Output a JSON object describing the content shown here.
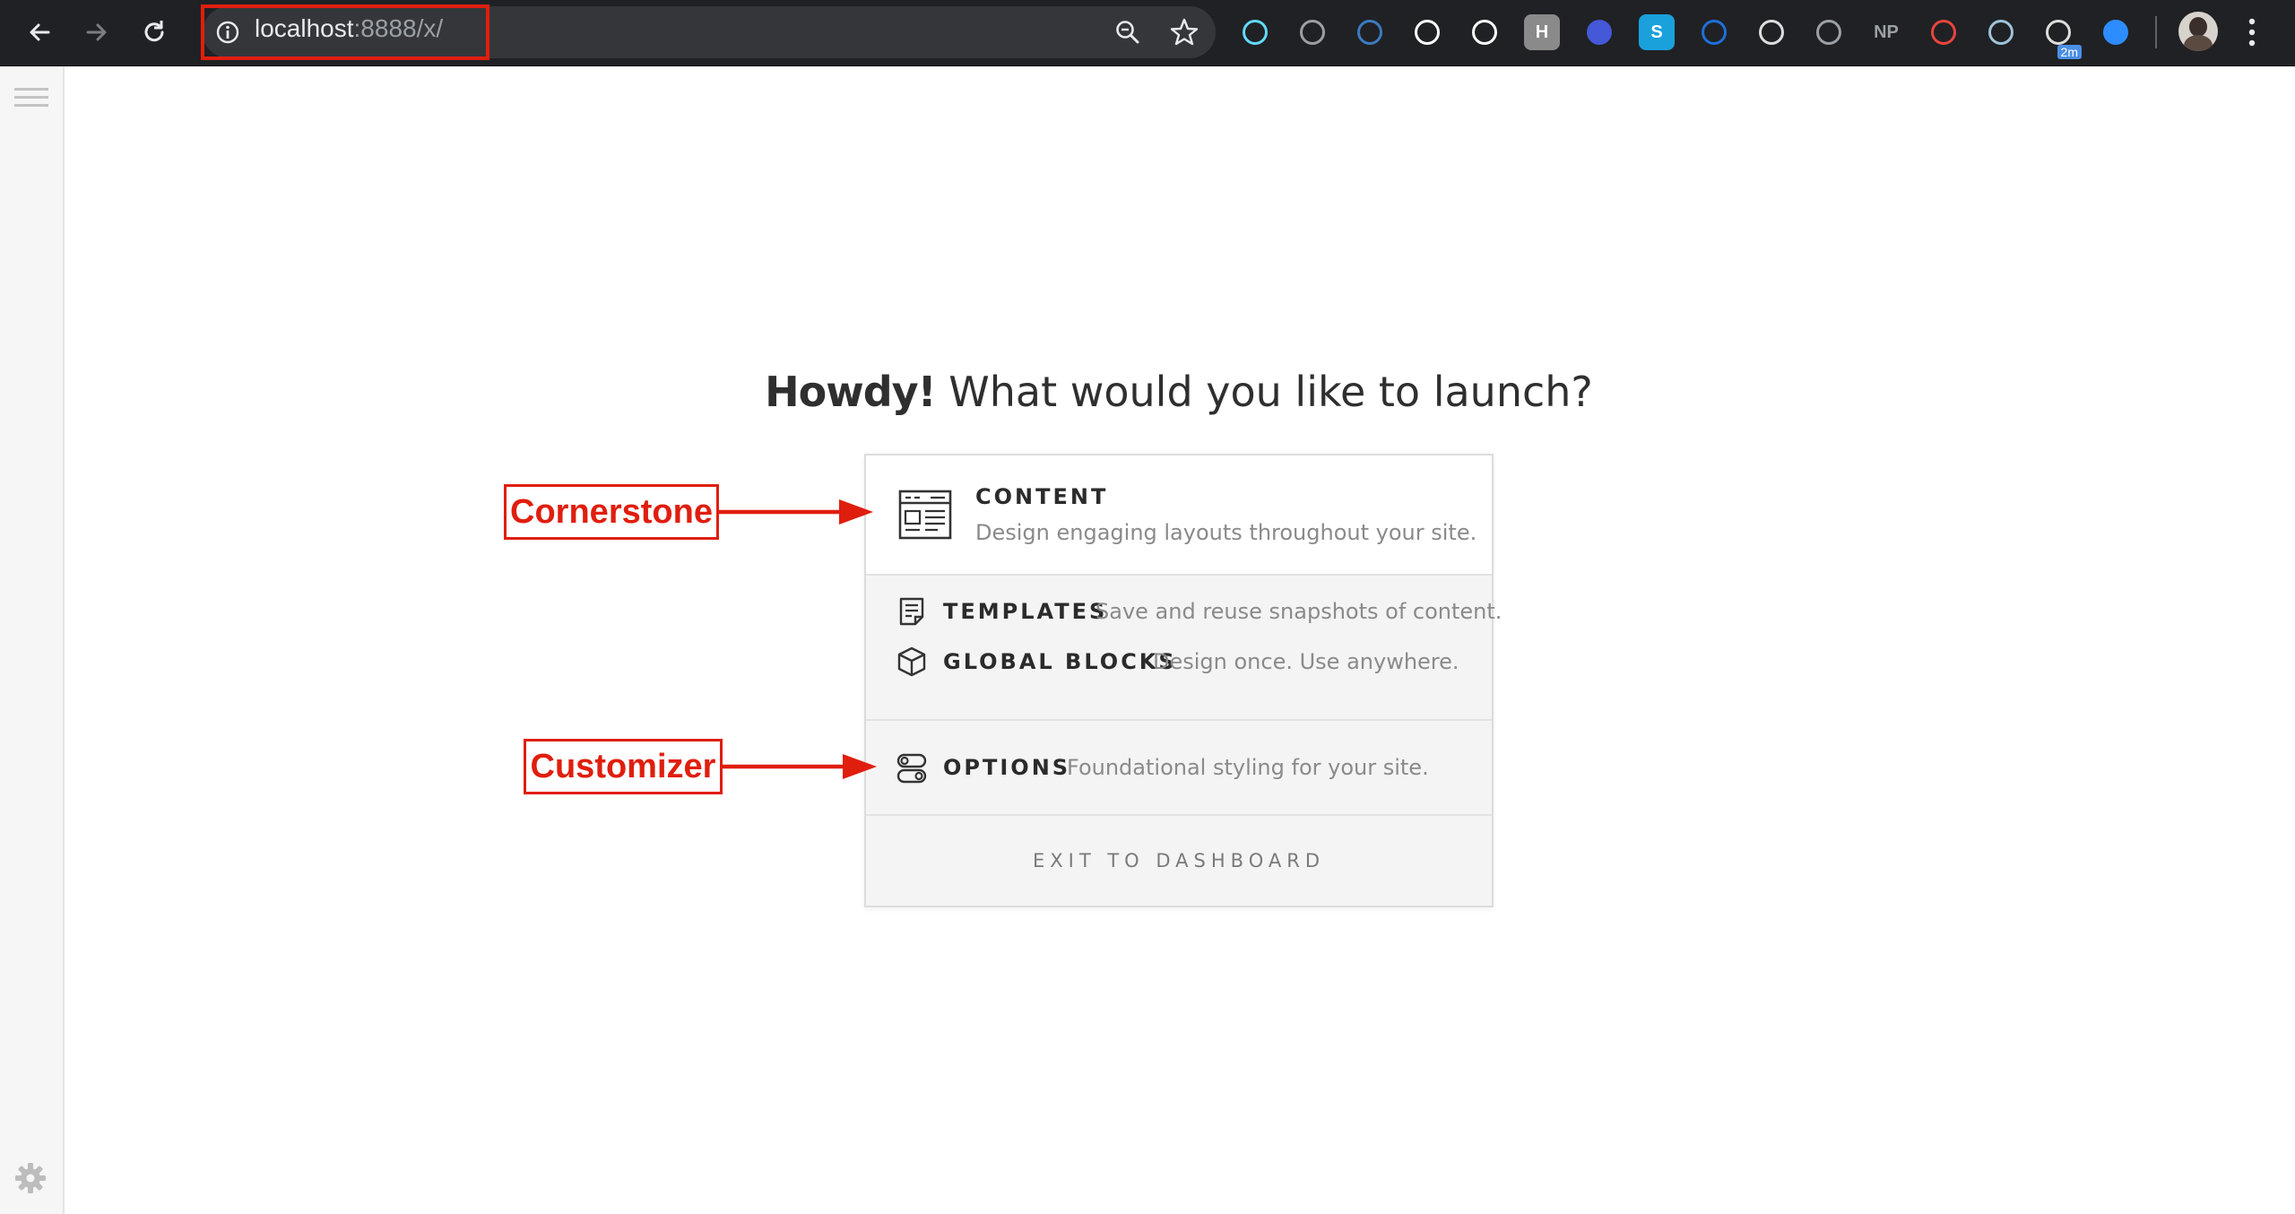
{
  "browser": {
    "url_host": "localhost",
    "url_rest": ":8888/x/",
    "extensions": [
      {
        "name": "react-devtools-icon",
        "color": "#61dafb"
      },
      {
        "name": "vue-devtools-icon",
        "color": "#9aa0a6"
      },
      {
        "name": "eyedropper-icon",
        "color": "#3b7bbf"
      },
      {
        "name": "color-picker-icon",
        "color": "#ffffff"
      },
      {
        "name": "json-viewer-icon",
        "color": "#ffffff"
      },
      {
        "name": "headings-icon",
        "color": "#8a8a8a",
        "glyph": "H"
      },
      {
        "name": "time-tracker-icon",
        "color": "#4458d8"
      },
      {
        "name": "skype-icon",
        "color": "#1aa1dc",
        "glyph": "S"
      },
      {
        "name": "triangle-ext-icon",
        "color": "#1e6fd9"
      },
      {
        "name": "camera-ext-icon",
        "color": "#dddddd"
      },
      {
        "name": "puzzle-ext-icon",
        "color": "#9aa0a6"
      },
      {
        "name": "np-ext-icon",
        "color": "#9aa0a6",
        "glyph": "NP"
      },
      {
        "name": "spiral-ext-icon",
        "color": "#e8453c"
      },
      {
        "name": "eye-ext-icon",
        "color": "#9fc3d9"
      },
      {
        "name": "download-ext-icon",
        "color": "#dddddd",
        "badge": "2m"
      },
      {
        "name": "zoom-ext-icon",
        "color": "#2d8cff"
      }
    ]
  },
  "launcher": {
    "greeting": "Howdy!",
    "question": " What would you like to launch?",
    "content": {
      "title": "CONTENT",
      "desc": "Design engaging layouts throughout your site."
    },
    "templates": {
      "title": "TEMPLATES",
      "desc": "Save and reuse snapshots of content."
    },
    "global_blocks": {
      "title": "GLOBAL BLOCKS",
      "desc": "Design once. Use anywhere."
    },
    "options": {
      "title": "OPTIONS",
      "desc": "Foundational styling for your site."
    },
    "exit": "EXIT TO DASHBOARD"
  },
  "annotations": {
    "cornerstone": "Cornerstone",
    "customizer": "Customizer",
    "color": "#e01e0e"
  }
}
